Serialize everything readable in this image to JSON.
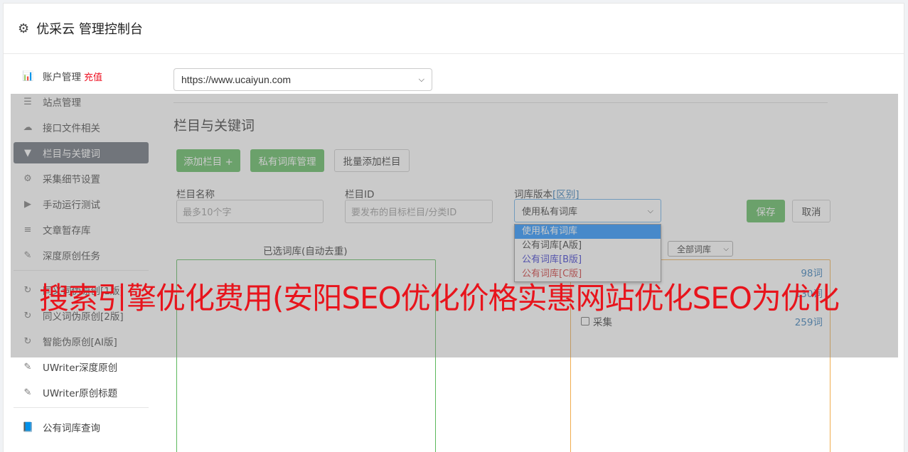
{
  "app": {
    "title": "优采云 管理控制台",
    "icon": "gear-icon"
  },
  "sidebar": {
    "items": [
      {
        "label": "账户管理",
        "badge": "充值",
        "icon": "bar-chart-icon"
      },
      {
        "label": "站点管理",
        "icon": "server-icon"
      },
      {
        "label": "接口文件相关",
        "icon": "cloud-upload-icon"
      },
      {
        "label": "栏目与关键词",
        "icon": "filter-icon",
        "active": true
      },
      {
        "label": "采集细节设置",
        "icon": "cogs-icon"
      },
      {
        "label": "手动运行测试",
        "icon": "play-icon"
      },
      {
        "label": "文章暂存库",
        "icon": "database-icon"
      },
      {
        "label": "深度原创任务",
        "icon": "edit-icon"
      },
      {
        "label": "同义词伪原创[1版]",
        "icon": "refresh-icon"
      },
      {
        "label": "同义词伪原创[2版]",
        "icon": "refresh-icon"
      },
      {
        "label": "智能伪原创[AI版]",
        "icon": "refresh-icon"
      },
      {
        "label": "UWriter深度原创",
        "icon": "edit-icon"
      },
      {
        "label": "UWriter原创标题",
        "icon": "edit-icon"
      },
      {
        "label": "公有词库查询",
        "icon": "book-icon"
      }
    ]
  },
  "main": {
    "site_select": "https://www.ucaiyun.com",
    "section_title": "栏目与关键词",
    "buttons": {
      "add_column": "添加栏目 +",
      "private_lib": "私有词库管理",
      "batch_add": "批量添加栏目",
      "save": "保存",
      "cancel": "取消"
    },
    "fields": {
      "name_label": "栏目名称",
      "name_placeholder": "最多10个字",
      "id_label": "栏目ID",
      "id_placeholder": "要发布的目标栏目/分类ID",
      "version_label": "词库版本",
      "version_link": "[区别]",
      "version_value": "使用私有词库"
    },
    "version_options": [
      "使用私有词库",
      "公有词库[A版]",
      "公有词库[B版]",
      "公有词库[C版]"
    ],
    "version_option_colors": [
      "#ffffff",
      "#333333",
      "#3333cc",
      "#cc3333"
    ],
    "selected_lib_label": "已选词库(自动去重)",
    "filter_select": "全部词库",
    "word_rows": [
      {
        "name": "",
        "count": "98词"
      },
      {
        "name": "",
        "count": "130词"
      },
      {
        "name": "采集",
        "count": "259词"
      }
    ]
  },
  "banner": "搜索引擎优化费用(安阳SEO优化价格实惠网站优化SEO为优化"
}
